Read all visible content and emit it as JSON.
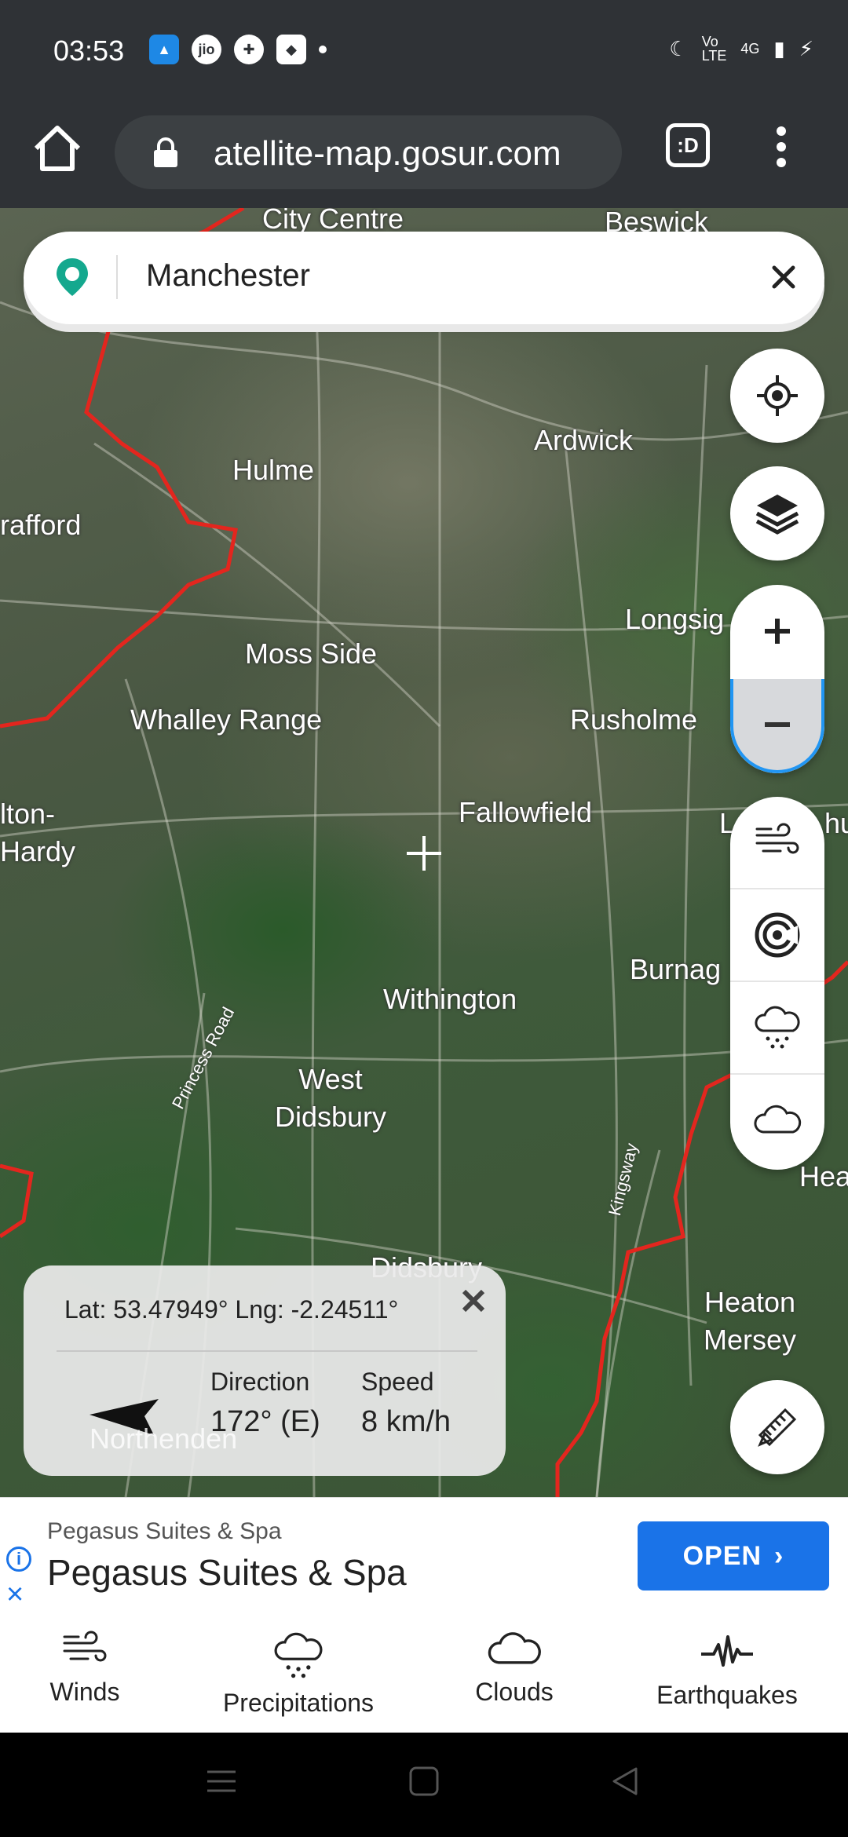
{
  "status_bar": {
    "time": "03:53",
    "network": "4G"
  },
  "browser": {
    "url": "atellite-map.gosur.com",
    "tabs_label": ":D"
  },
  "search": {
    "value": "Manchester"
  },
  "map": {
    "labels": {
      "city_centre": "City Centre",
      "beswick": "Beswick",
      "ardwick": "Ardwick",
      "hulme": "Hulme",
      "trafford": "rafford",
      "longsight": "Longsig",
      "moss_side": "Moss Side",
      "whalley_range": "Whalley Range",
      "rusholme": "Rusholme",
      "fallowfield": "Fallowfield",
      "levenshulme": "L",
      "levenshulme2": "hu",
      "chorlton": "lton-\nHardy",
      "burnage": "Burnag",
      "withington": "Withington",
      "west_didsbury": "West\nDidsbury",
      "heaton_chapel": "Hea",
      "didsbury": "Didsbury",
      "heaton_mersey": "Heaton\nMersey",
      "northenden": "Northenden",
      "princess_road": "Princess Road",
      "kingsway": "Kingsway"
    }
  },
  "info_panel": {
    "lat_lng": "Lat: 53.47949°   Lng: -2.24511°",
    "direction_label": "Direction",
    "direction_value": "172° (E)",
    "speed_label": "Speed",
    "speed_value": "8 km/h"
  },
  "ad": {
    "small_title": "Pegasus Suites & Spa",
    "title": "Pegasus Suites & Spa",
    "button": "OPEN"
  },
  "tabs": [
    {
      "label": "Winds"
    },
    {
      "label": "Precipitations"
    },
    {
      "label": "Clouds"
    },
    {
      "label": "Earthquakes"
    }
  ]
}
